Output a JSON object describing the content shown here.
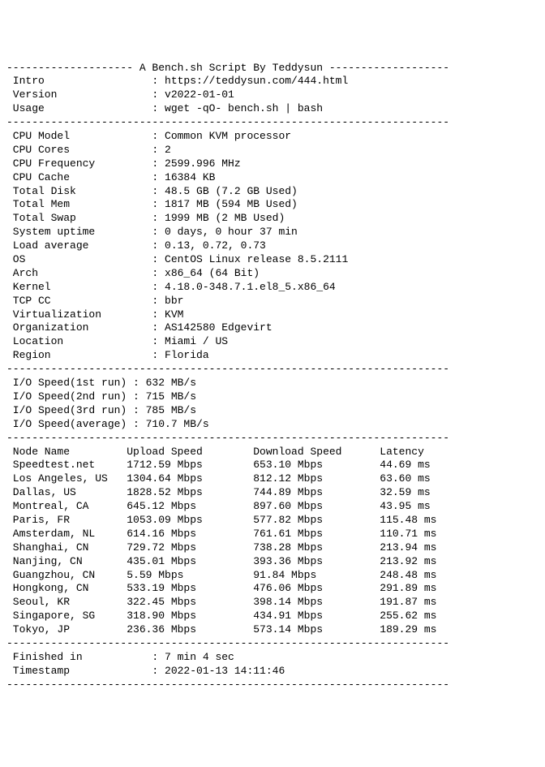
{
  "header": {
    "title": "A Bench.sh Script By Teddysun",
    "intro_label": "Intro",
    "intro_value": "https://teddysun.com/444.html",
    "version_label": "Version",
    "version_value": "v2022-01-01",
    "usage_label": "Usage",
    "usage_value": "wget -qO- bench.sh | bash"
  },
  "system": {
    "cpu_model_label": "CPU Model",
    "cpu_model_value": "Common KVM processor",
    "cpu_cores_label": "CPU Cores",
    "cpu_cores_value": "2",
    "cpu_freq_label": "CPU Frequency",
    "cpu_freq_value": "2599.996 MHz",
    "cpu_cache_label": "CPU Cache",
    "cpu_cache_value": "16384 KB",
    "total_disk_label": "Total Disk",
    "total_disk_value": "48.5 GB (7.2 GB Used)",
    "total_mem_label": "Total Mem",
    "total_mem_value": "1817 MB (594 MB Used)",
    "total_swap_label": "Total Swap",
    "total_swap_value": "1999 MB (2 MB Used)",
    "uptime_label": "System uptime",
    "uptime_value": "0 days, 0 hour 37 min",
    "load_label": "Load average",
    "load_value": "0.13, 0.72, 0.73",
    "os_label": "OS",
    "os_value": "CentOS Linux release 8.5.2111",
    "arch_label": "Arch",
    "arch_value": "x86_64 (64 Bit)",
    "kernel_label": "Kernel",
    "kernel_value": "4.18.0-348.7.1.el8_5.x86_64",
    "tcp_label": "TCP CC",
    "tcp_value": "bbr",
    "virt_label": "Virtualization",
    "virt_value": "KVM",
    "org_label": "Organization",
    "org_value": "AS142580 Edgevirt",
    "loc_label": "Location",
    "loc_value": "Miami / US",
    "region_label": "Region",
    "region_value": "Florida"
  },
  "io": {
    "r1_label": "I/O Speed(1st run)",
    "r1_value": "632 MB/s",
    "r2_label": "I/O Speed(2nd run)",
    "r2_value": "715 MB/s",
    "r3_label": "I/O Speed(3rd run)",
    "r3_value": "785 MB/s",
    "avg_label": "I/O Speed(average)",
    "avg_value": "710.7 MB/s"
  },
  "speedtest": {
    "h_node": "Node Name",
    "h_up": "Upload Speed",
    "h_down": "Download Speed",
    "h_lat": "Latency",
    "rows": [
      {
        "node": "Speedtest.net",
        "up": "1712.59 Mbps",
        "down": "653.10 Mbps",
        "lat": "44.69 ms"
      },
      {
        "node": "Los Angeles, US",
        "up": "1304.64 Mbps",
        "down": "812.12 Mbps",
        "lat": "63.60 ms"
      },
      {
        "node": "Dallas, US",
        "up": "1828.52 Mbps",
        "down": "744.89 Mbps",
        "lat": "32.59 ms"
      },
      {
        "node": "Montreal, CA",
        "up": "645.12 Mbps",
        "down": "897.60 Mbps",
        "lat": "43.95 ms"
      },
      {
        "node": "Paris, FR",
        "up": "1053.09 Mbps",
        "down": "577.82 Mbps",
        "lat": "115.48 ms"
      },
      {
        "node": "Amsterdam, NL",
        "up": "614.16 Mbps",
        "down": "761.61 Mbps",
        "lat": "110.71 ms"
      },
      {
        "node": "Shanghai, CN",
        "up": "729.72 Mbps",
        "down": "738.28 Mbps",
        "lat": "213.94 ms"
      },
      {
        "node": "Nanjing, CN",
        "up": "435.01 Mbps",
        "down": "393.36 Mbps",
        "lat": "213.92 ms"
      },
      {
        "node": "Guangzhou, CN",
        "up": "5.59 Mbps",
        "down": "91.84 Mbps",
        "lat": "248.48 ms"
      },
      {
        "node": "Hongkong, CN",
        "up": "533.19 Mbps",
        "down": "476.06 Mbps",
        "lat": "291.89 ms"
      },
      {
        "node": "Seoul, KR",
        "up": "322.45 Mbps",
        "down": "398.14 Mbps",
        "lat": "191.87 ms"
      },
      {
        "node": "Singapore, SG",
        "up": "318.90 Mbps",
        "down": "434.91 Mbps",
        "lat": "255.62 ms"
      },
      {
        "node": "Tokyo, JP",
        "up": "236.36 Mbps",
        "down": "573.14 Mbps",
        "lat": "189.29 ms"
      }
    ]
  },
  "footer": {
    "finished_label": "Finished in",
    "finished_value": "7 min 4 sec",
    "timestamp_label": "Timestamp",
    "timestamp_value": "2022-01-13 14:11:46"
  },
  "chart_data": {
    "type": "table",
    "title": "A Bench.sh Script By Teddysun",
    "columns": [
      "Node Name",
      "Upload Speed (Mbps)",
      "Download Speed (Mbps)",
      "Latency (ms)"
    ],
    "rows": [
      [
        "Speedtest.net",
        1712.59,
        653.1,
        44.69
      ],
      [
        "Los Angeles, US",
        1304.64,
        812.12,
        63.6
      ],
      [
        "Dallas, US",
        1828.52,
        744.89,
        32.59
      ],
      [
        "Montreal, CA",
        645.12,
        897.6,
        43.95
      ],
      [
        "Paris, FR",
        1053.09,
        577.82,
        115.48
      ],
      [
        "Amsterdam, NL",
        614.16,
        761.61,
        110.71
      ],
      [
        "Shanghai, CN",
        729.72,
        738.28,
        213.94
      ],
      [
        "Nanjing, CN",
        435.01,
        393.36,
        213.92
      ],
      [
        "Guangzhou, CN",
        5.59,
        91.84,
        248.48
      ],
      [
        "Hongkong, CN",
        533.19,
        476.06,
        291.89
      ],
      [
        "Seoul, KR",
        322.45,
        398.14,
        191.87
      ],
      [
        "Singapore, SG",
        318.9,
        434.91,
        255.62
      ],
      [
        "Tokyo, JP",
        236.36,
        573.14,
        189.29
      ]
    ]
  }
}
